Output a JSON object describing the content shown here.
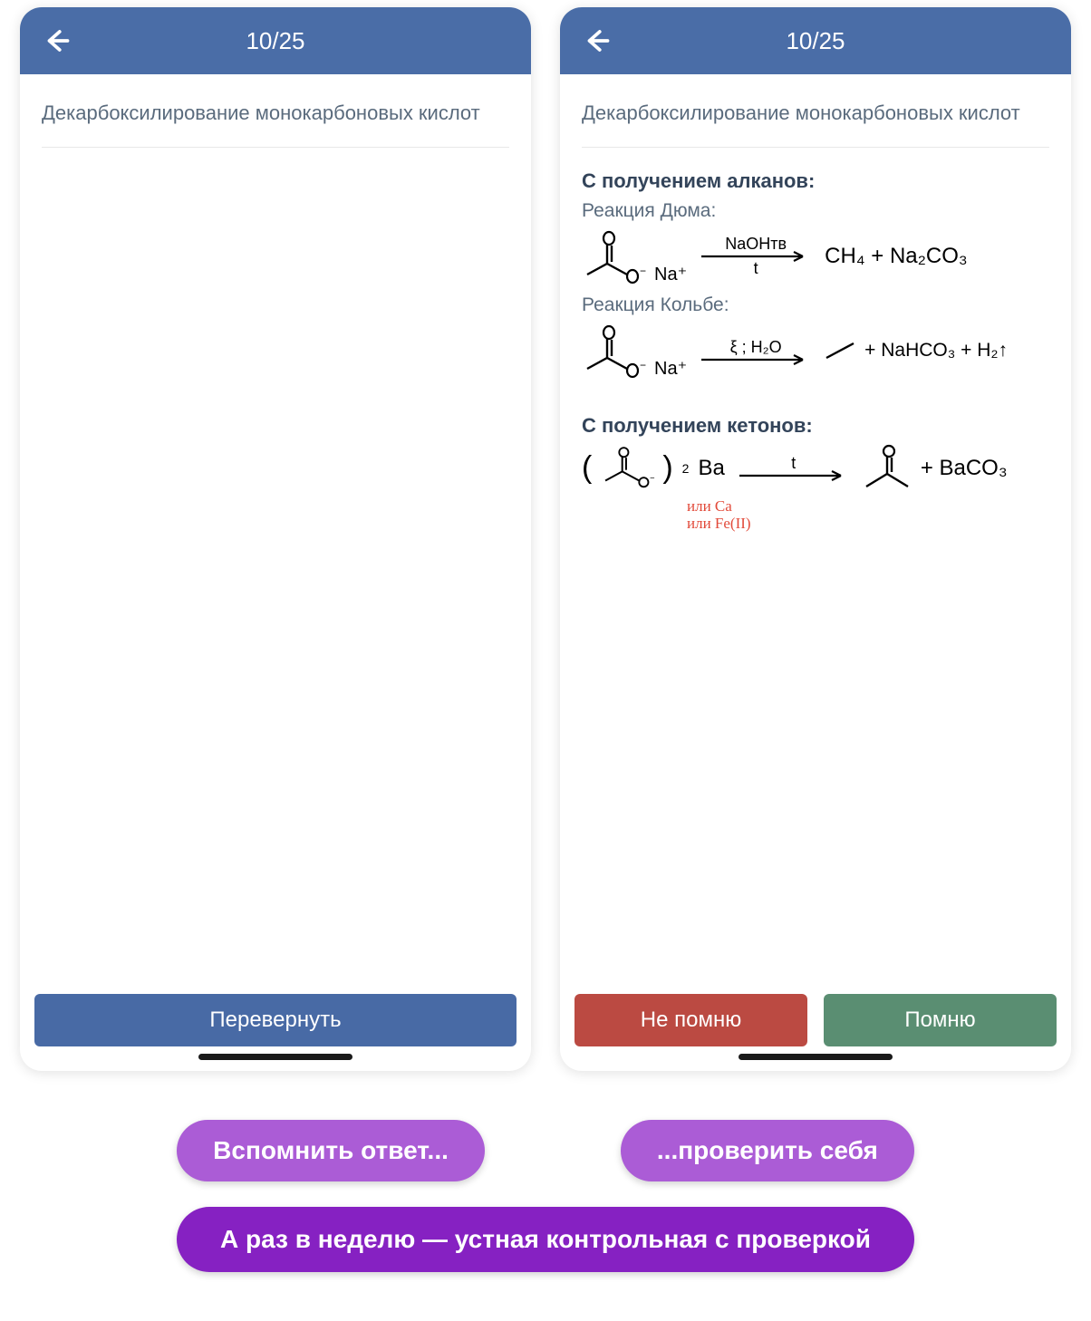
{
  "counter": "10/25",
  "question": "Декарбоксилирование монокарбоновых кислот",
  "answer": {
    "section1": {
      "title": "С получением алканов:",
      "dumas": {
        "label": "Реакция Дюма:",
        "cation": "Na⁺",
        "arrow_top": "NaOHтв",
        "arrow_bottom": "t",
        "products": "CH₄ + Na₂CO₃"
      },
      "kolbe": {
        "label": "Реакция Кольбе:",
        "cation": "Na⁺",
        "arrow_top": "ξ ; H₂O",
        "arrow_bottom": "",
        "products_tail": " + NaHCO₃ + H₂↑"
      }
    },
    "section2": {
      "title": "С получением кетонов:",
      "reagent_sub": "2",
      "reagent": "Ba",
      "note": "или Ca\nили Fe(II)",
      "arrow_top": "t",
      "products_tail": " + BaCO₃"
    }
  },
  "buttons": {
    "flip": "Перевернуть",
    "dont_remember": "Не помню",
    "remember": "Помню"
  },
  "pills": {
    "left": "Вспомнить ответ...",
    "right": "...проверить себя",
    "wide": "А раз в неделю — устная контрольная с проверкой"
  }
}
